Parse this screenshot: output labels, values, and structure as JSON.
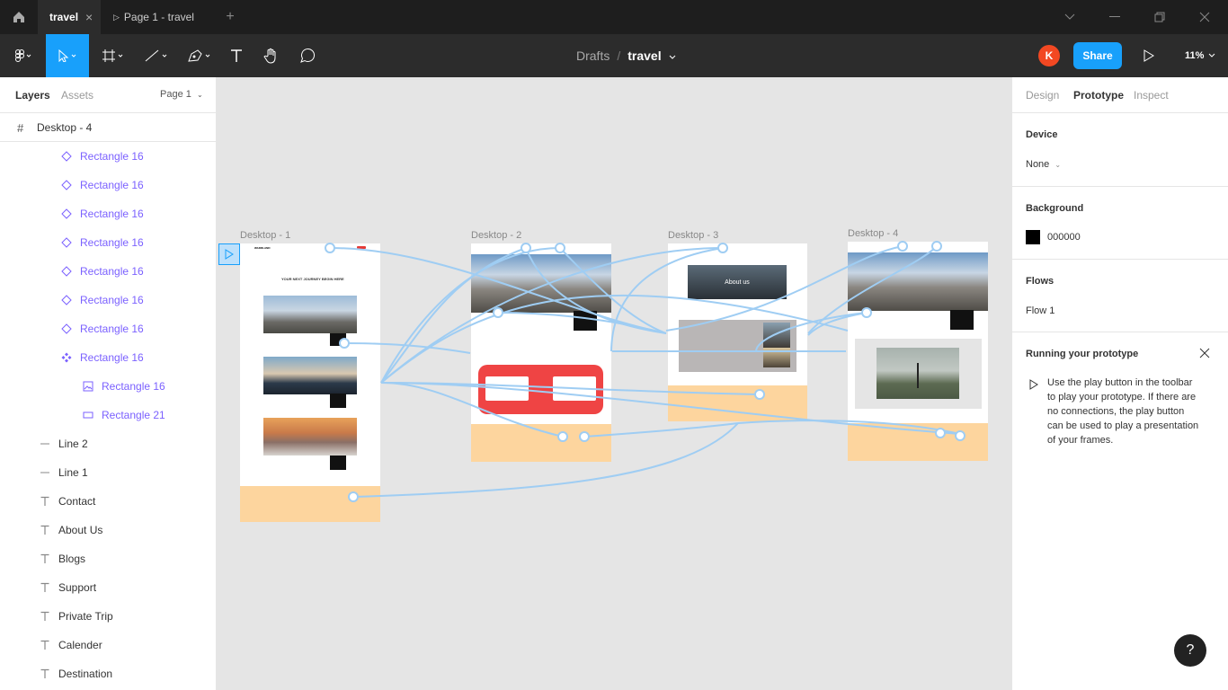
{
  "tabs": {
    "active": "travel",
    "second": "Page 1 - travel"
  },
  "toolbar": {
    "path_root": "Drafts",
    "path_sep": "/",
    "file_name": "travel",
    "avatar_letter": "K",
    "share_label": "Share",
    "zoom": "11%"
  },
  "left_panel": {
    "tab_layers": "Layers",
    "tab_assets": "Assets",
    "page_select": "Page 1",
    "frame_name": "Desktop - 4",
    "layers": [
      {
        "icon": "diamond-icon",
        "label": "Rectangle 16",
        "kind": "component"
      },
      {
        "icon": "diamond-icon",
        "label": "Rectangle 16",
        "kind": "component"
      },
      {
        "icon": "diamond-icon",
        "label": "Rectangle 16",
        "kind": "component"
      },
      {
        "icon": "diamond-icon",
        "label": "Rectangle 16",
        "kind": "component"
      },
      {
        "icon": "diamond-icon",
        "label": "Rectangle 16",
        "kind": "component"
      },
      {
        "icon": "diamond-icon",
        "label": "Rectangle 16",
        "kind": "component"
      },
      {
        "icon": "diamond-icon",
        "label": "Rectangle 16",
        "kind": "component"
      },
      {
        "icon": "component-icon",
        "label": "Rectangle 16",
        "kind": "component"
      },
      {
        "icon": "image-icon",
        "label": "Rectangle 16",
        "kind": "component"
      },
      {
        "icon": "rectangle-icon",
        "label": "Rectangle 21",
        "kind": "component"
      },
      {
        "icon": "line-icon",
        "label": "Line 2",
        "kind": "line"
      },
      {
        "icon": "line-icon",
        "label": "Line 1",
        "kind": "line"
      },
      {
        "icon": "text-icon",
        "label": "Contact",
        "kind": "text"
      },
      {
        "icon": "text-icon",
        "label": "About Us",
        "kind": "text"
      },
      {
        "icon": "text-icon",
        "label": "Blogs",
        "kind": "text"
      },
      {
        "icon": "text-icon",
        "label": "Support",
        "kind": "text"
      },
      {
        "icon": "text-icon",
        "label": "Private Trip",
        "kind": "text"
      },
      {
        "icon": "text-icon",
        "label": "Calender",
        "kind": "text"
      },
      {
        "icon": "text-icon",
        "label": "Destination",
        "kind": "text"
      }
    ]
  },
  "canvas": {
    "frames": [
      "Desktop - 1",
      "Desktop - 2",
      "Desktop - 3",
      "Desktop - 4"
    ],
    "hero_text": "YOUR NEXT JOURNEY BEGIN HERE",
    "about_text": "About us",
    "brand": "WADRLAND"
  },
  "right_panel": {
    "tab_design": "Design",
    "tab_prototype": "Prototype",
    "tab_inspect": "Inspect",
    "device_title": "Device",
    "device_value": "None",
    "background_title": "Background",
    "background_hex": "000000",
    "background_color": "#000000",
    "flows_title": "Flows",
    "flow_1": "Flow 1",
    "running_title": "Running your prototype",
    "running_text": "Use the play button in the toolbar to play your prototype. If there are no connections, the play button can be used to play a presentation of your frames.",
    "help": "?"
  },
  "colors": {
    "accent": "#18a0fb",
    "component": "#7b61ff",
    "connector": "#9fcdf3"
  }
}
